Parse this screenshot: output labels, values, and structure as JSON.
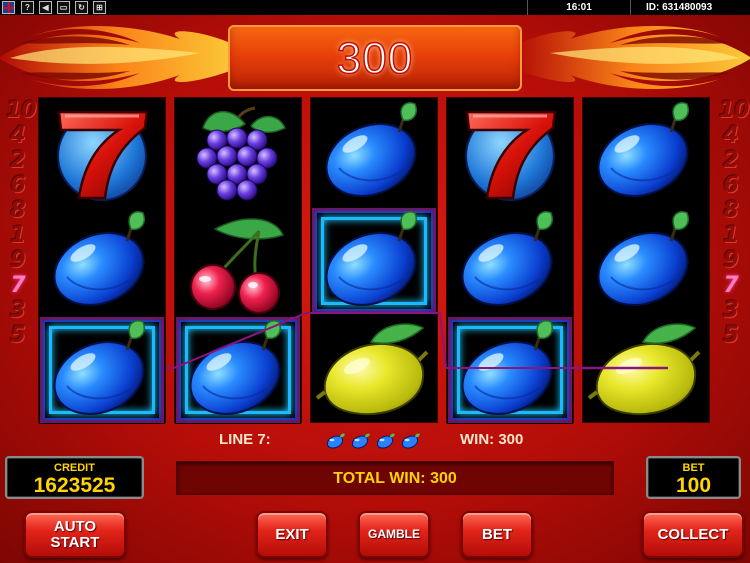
{
  "topbar": {
    "icons": [
      "uk-flag-icon",
      "help-icon",
      "sound-icon",
      "fullscreen-icon",
      "reload-icon",
      "paytable-icon"
    ],
    "help_glyph": "?",
    "sound_glyph": "◀",
    "fullscreen_glyph": "▭",
    "reload_glyph": "↻",
    "paytable_glyph": "⊞",
    "time": "16:01",
    "id": "ID: 631480093"
  },
  "header": {
    "win_amount": "300"
  },
  "lines": {
    "left": [
      "10",
      "4",
      "2",
      "6",
      "8",
      "1",
      "9",
      "7",
      "3",
      "5"
    ],
    "right": [
      "10",
      "4",
      "2",
      "6",
      "8",
      "1",
      "9",
      "7",
      "3",
      "5"
    ],
    "active": "7"
  },
  "reels": [
    [
      "seven",
      "plum",
      "plum"
    ],
    [
      "grapes",
      "cherries",
      "plum"
    ],
    [
      "plum",
      "plum",
      "lemon"
    ],
    [
      "seven",
      "plum",
      "plum"
    ],
    [
      "plum",
      "plum",
      "lemon"
    ]
  ],
  "winning_cells": [
    [
      0,
      2
    ],
    [
      1,
      2
    ],
    [
      2,
      1
    ],
    [
      3,
      2
    ]
  ],
  "info": {
    "line_label": "LINE 7:",
    "line_symbol": "plum",
    "line_symbol_count": 4,
    "win_label": "WIN: 300"
  },
  "credit": {
    "label": "CREDIT",
    "value": "1623525"
  },
  "bet": {
    "label": "BET",
    "value": "100"
  },
  "total_win": "TOTAL WIN: 300",
  "buttons": {
    "autostart_line1": "AUTO",
    "autostart_line2": "START",
    "exit": "EXIT",
    "gamble": "GAMBLE",
    "bet": "BET",
    "collect": "COLLECT"
  },
  "colors": {
    "background": "#c4130c",
    "meter_text": "#ffd400",
    "active_line": "#ff7ec0",
    "win_frame": "#1bb9ff"
  }
}
